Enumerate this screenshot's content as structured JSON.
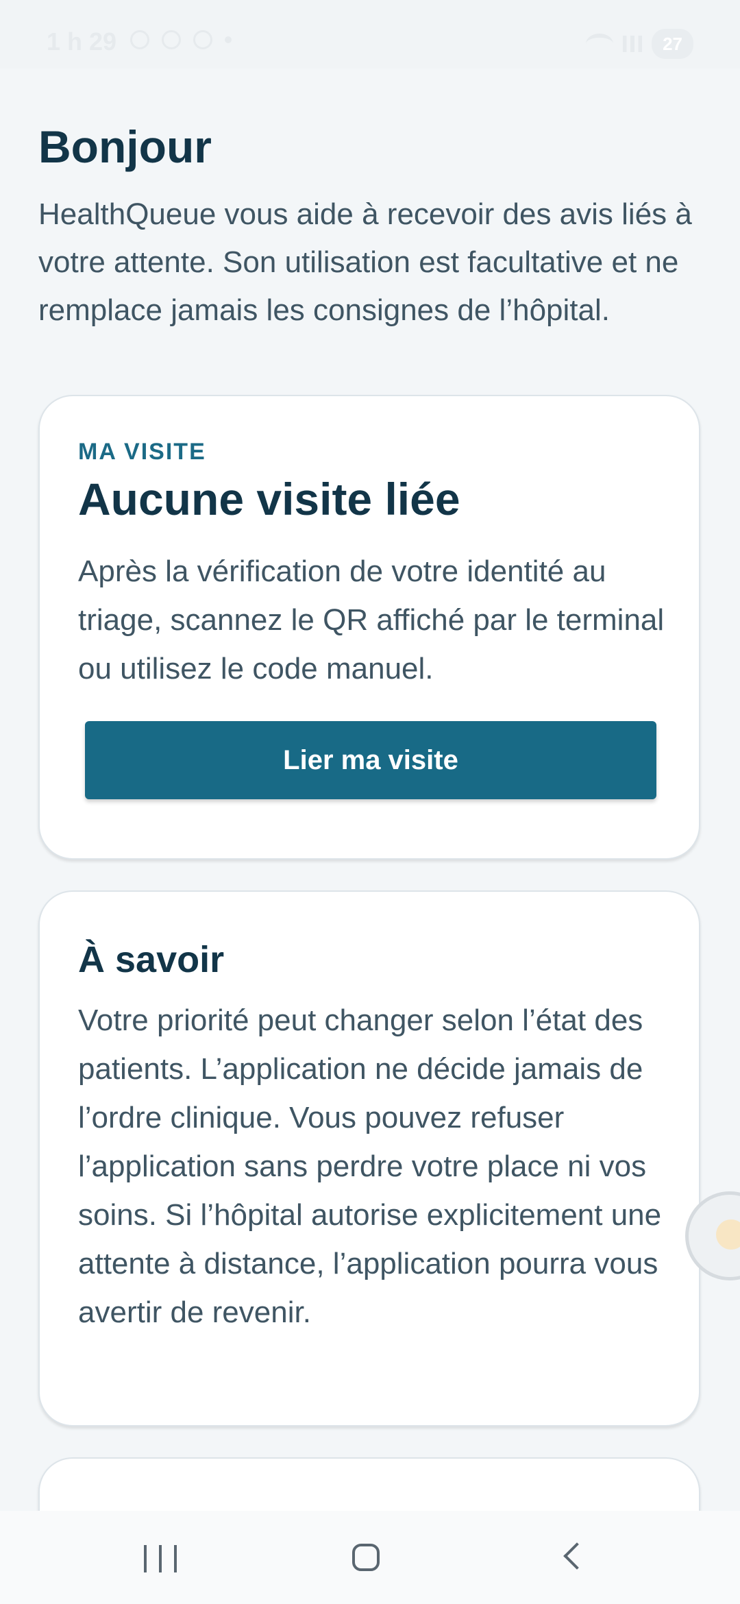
{
  "status_bar": {
    "time": "1 h 29",
    "battery": "27"
  },
  "header": {
    "title": "Bonjour",
    "intro": "HealthQueue vous aide à recevoir des avis liés à votre attente. Son utilisation est facultative et ne remplace jamais les consignes de l’hôpital."
  },
  "visit_card": {
    "eyebrow": "MA VISITE",
    "title": "Aucune visite liée",
    "body": "Après la vérification de votre identité au triage, scannez le QR affiché par le terminal ou utilisez le code manuel.",
    "button_label": "Lier ma visite"
  },
  "info_card": {
    "title": "À savoir",
    "body": "Votre priorité peut changer selon l’état des patients. L’application ne décide jamais de l’ordre clinique. Vous pouvez refuser l’application sans perdre votre place ni vos soins. Si l’hôpital autorise explicitement une attente à distance, l’application pourra vous avertir de revenir."
  },
  "colors": {
    "primary": "#186a86",
    "heading": "#123548",
    "body_text": "#3f5563",
    "background": "#f3f6f8"
  },
  "icons": {
    "status_left": [
      "nearby-share-icon",
      "bulb-icon",
      "chrome-icon",
      "dot-icon"
    ],
    "status_right": [
      "wifi-icon",
      "signal-icon",
      "battery-icon"
    ],
    "navigation": [
      "recents-icon",
      "home-icon",
      "back-icon"
    ],
    "floating": "assistant-bubble-icon"
  }
}
